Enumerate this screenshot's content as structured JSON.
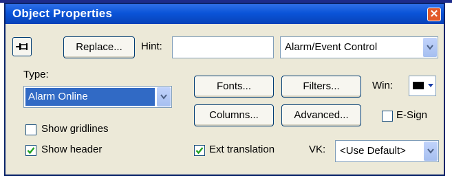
{
  "window": {
    "title": "Object Properties"
  },
  "toolbar": {
    "replace_label": "Replace...",
    "hint_label": "Hint:",
    "hint_value": "",
    "control_type_value": "Alarm/Event Control"
  },
  "type": {
    "label": "Type:",
    "value": "Alarm Online"
  },
  "buttons": {
    "fonts": "Fonts...",
    "filters": "Filters...",
    "columns": "Columns...",
    "advanced": "Advanced..."
  },
  "win": {
    "label": "Win:",
    "color": "#000000"
  },
  "checkboxes": {
    "esign": {
      "label": "E-Sign",
      "checked": false
    },
    "show_gridlines": {
      "label": "Show gridlines",
      "checked": false
    },
    "show_header": {
      "label": "Show header",
      "checked": true
    },
    "ext_translation": {
      "label": "Ext translation",
      "checked": true
    }
  },
  "vk": {
    "label": "VK:",
    "value": "<Use Default>"
  },
  "colors": {
    "titlebar": "#0a54d8",
    "selection": "#316ac5",
    "close": "#e25a2a"
  }
}
